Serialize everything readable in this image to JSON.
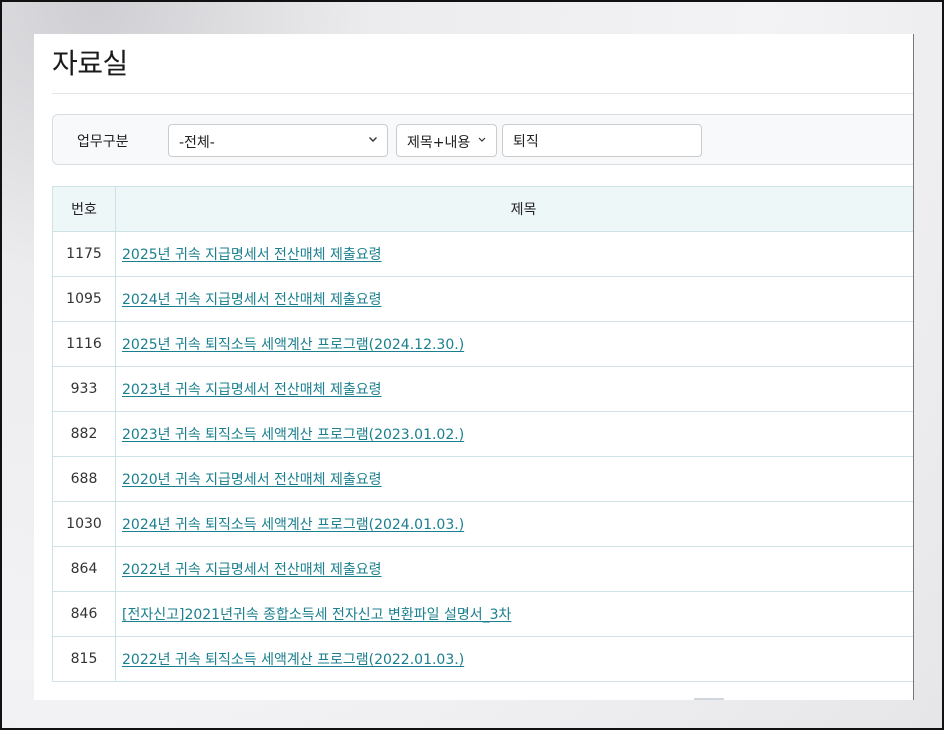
{
  "page": {
    "title": "자료실"
  },
  "search": {
    "label": "업무구분",
    "category_value": "-전체-",
    "field_value": "제목+내용",
    "keyword_value": "퇴직"
  },
  "table": {
    "headers": {
      "num": "번호",
      "subject": "제목"
    },
    "rows": [
      {
        "num": "1175",
        "subject": "2025년 귀속 지급명세서 전산매체 제출요령"
      },
      {
        "num": "1095",
        "subject": "2024년 귀속 지급명세서 전산매체 제출요령"
      },
      {
        "num": "1116",
        "subject": "2025년 귀속 퇴직소득 세액계산 프로그램(2024.12.30.)"
      },
      {
        "num": "933",
        "subject": "2023년 귀속 지급명세서 전산매체 제출요령"
      },
      {
        "num": "882",
        "subject": "2023년 귀속 퇴직소득 세액계산 프로그램(2023.01.02.)"
      },
      {
        "num": "688",
        "subject": "2020년 귀속 지급명세서 전산매체 제출요령"
      },
      {
        "num": "1030",
        "subject": "2024년 귀속 퇴직소득 세액계산 프로그램(2024.01.03.)"
      },
      {
        "num": "864",
        "subject": "2022년 귀속 지급명세서 전산매체 제출요령"
      },
      {
        "num": "846",
        "subject": "[전자신고]2021년귀속 종합소득세 전자신고 변환파일 설명서_3차"
      },
      {
        "num": "815",
        "subject": "2022년 귀속 퇴직소득 세액계산 프로그램(2022.01.03.)"
      }
    ]
  },
  "colors": {
    "link": "#1a7f8e",
    "header_bg": "#eef7f8",
    "border": "#cfe3e6"
  }
}
